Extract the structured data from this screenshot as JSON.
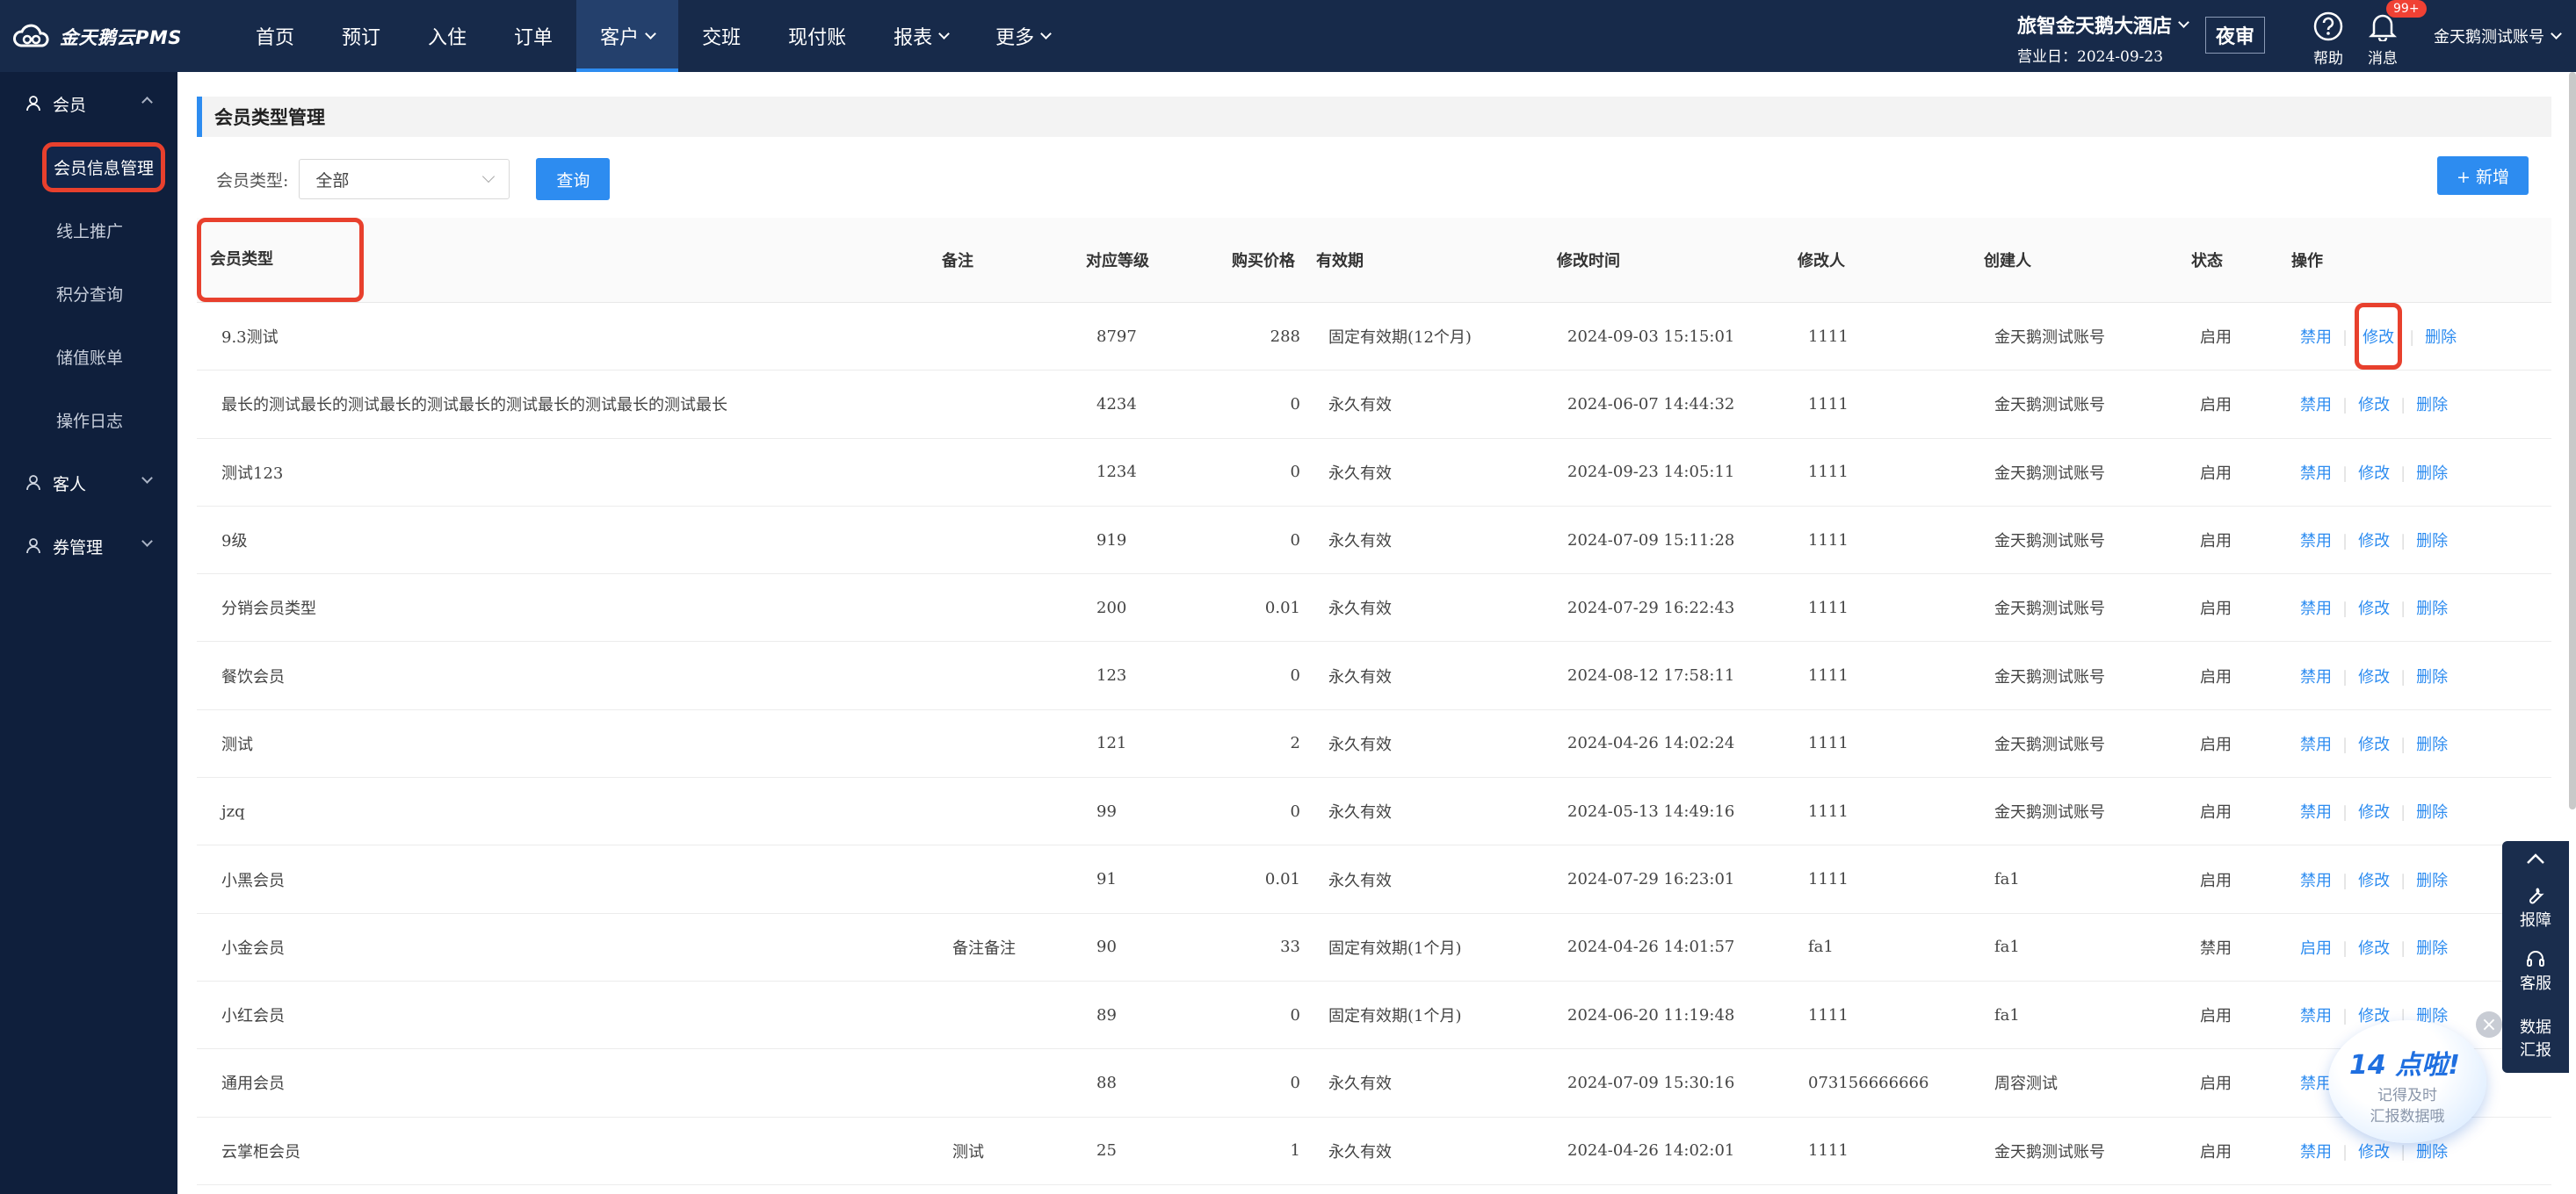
{
  "app": {
    "logo_text": "金天鹅云PMS"
  },
  "nav": {
    "items": [
      {
        "label": "首页"
      },
      {
        "label": "预订"
      },
      {
        "label": "入住"
      },
      {
        "label": "订单"
      },
      {
        "label": "客户"
      },
      {
        "label": "交班"
      },
      {
        "label": "现付账"
      },
      {
        "label": "报表"
      },
      {
        "label": "更多"
      }
    ]
  },
  "header": {
    "hotel_name": "旅智金天鹅大酒店",
    "business_date": "营业日：2024-09-23",
    "night_audit": "夜审",
    "help_label": "帮助",
    "message_label": "消息",
    "message_badge": "99+",
    "account": "金天鹅测试账号"
  },
  "sidebar": {
    "groups": [
      {
        "label": "会员",
        "items": [
          "会员信息管理",
          "线上推广",
          "积分查询",
          "储值账单",
          "操作日志"
        ]
      },
      {
        "label": "客人"
      },
      {
        "label": "券管理"
      }
    ]
  },
  "page": {
    "title": "会员类型管理",
    "filter_label": "会员类型:",
    "filter_value": "全部",
    "query_button": "查询",
    "add_button": "+ 新增"
  },
  "table": {
    "columns": [
      "会员类型",
      "备注",
      "对应等级",
      "购买价格",
      "有效期",
      "修改时间",
      "修改人",
      "创建人",
      "状态",
      "操作"
    ],
    "rows": [
      {
        "type": "9.3测试",
        "note": "",
        "level": "8797",
        "price": "288",
        "validity": "固定有效期(12个月)",
        "modified": "2024-09-03 15:15:01",
        "modifier": "1111",
        "creator": "金天鹅测试账号",
        "status": "启用",
        "toggle": "禁用"
      },
      {
        "type": "最长的测试最长的测试最长的测试最长的测试最长的测试最长的测试最长",
        "note": "",
        "level": "4234",
        "price": "0",
        "validity": "永久有效",
        "modified": "2024-06-07 14:44:32",
        "modifier": "1111",
        "creator": "金天鹅测试账号",
        "status": "启用",
        "toggle": "禁用"
      },
      {
        "type": "测试123",
        "note": "",
        "level": "1234",
        "price": "0",
        "validity": "永久有效",
        "modified": "2024-09-23 14:05:11",
        "modifier": "1111",
        "creator": "金天鹅测试账号",
        "status": "启用",
        "toggle": "禁用"
      },
      {
        "type": "9级",
        "note": "",
        "level": "919",
        "price": "0",
        "validity": "永久有效",
        "modified": "2024-07-09 15:11:28",
        "modifier": "1111",
        "creator": "金天鹅测试账号",
        "status": "启用",
        "toggle": "禁用"
      },
      {
        "type": "分销会员类型",
        "note": "",
        "level": "200",
        "price": "0.01",
        "validity": "永久有效",
        "modified": "2024-07-29 16:22:43",
        "modifier": "1111",
        "creator": "金天鹅测试账号",
        "status": "启用",
        "toggle": "禁用"
      },
      {
        "type": "餐饮会员",
        "note": "",
        "level": "123",
        "price": "0",
        "validity": "永久有效",
        "modified": "2024-08-12 17:58:11",
        "modifier": "1111",
        "creator": "金天鹅测试账号",
        "status": "启用",
        "toggle": "禁用"
      },
      {
        "type": "测试",
        "note": "",
        "level": "121",
        "price": "2",
        "validity": "永久有效",
        "modified": "2024-04-26 14:02:24",
        "modifier": "1111",
        "creator": "金天鹅测试账号",
        "status": "启用",
        "toggle": "禁用"
      },
      {
        "type": "jzq",
        "note": "",
        "level": "99",
        "price": "0",
        "validity": "永久有效",
        "modified": "2024-05-13 14:49:16",
        "modifier": "1111",
        "creator": "金天鹅测试账号",
        "status": "启用",
        "toggle": "禁用"
      },
      {
        "type": "小黑会员",
        "note": "",
        "level": "91",
        "price": "0.01",
        "validity": "永久有效",
        "modified": "2024-07-29 16:23:01",
        "modifier": "1111",
        "creator": "fa1",
        "status": "启用",
        "toggle": "禁用"
      },
      {
        "type": "小金会员",
        "note": "备注备注",
        "level": "90",
        "price": "33",
        "validity": "固定有效期(1个月)",
        "modified": "2024-04-26 14:01:57",
        "modifier": "fa1",
        "creator": "fa1",
        "status": "禁用",
        "toggle": "启用"
      },
      {
        "type": "小红会员",
        "note": "",
        "level": "89",
        "price": "0",
        "validity": "固定有效期(1个月)",
        "modified": "2024-06-20 11:19:48",
        "modifier": "1111",
        "creator": "fa1",
        "status": "启用",
        "toggle": "禁用"
      },
      {
        "type": "通用会员",
        "note": "",
        "level": "88",
        "price": "0",
        "validity": "永久有效",
        "modified": "2024-07-09 15:30:16",
        "modifier": "073156666666",
        "creator": "周容测试",
        "status": "启用",
        "toggle": "禁用"
      },
      {
        "type": "云掌柜会员",
        "note": "测试",
        "level": "25",
        "price": "1",
        "validity": "永久有效",
        "modified": "2024-04-26 14:02:01",
        "modifier": "1111",
        "creator": "金天鹅测试账号",
        "status": "启用",
        "toggle": "禁用"
      }
    ],
    "action_edit": "修改",
    "action_delete": "删除"
  },
  "tools": {
    "report_issue": "报障",
    "service": "客服",
    "data_report": "数据汇报"
  },
  "promo": {
    "title": "14 点啦!",
    "line1": "记得及时",
    "line2": "汇报数据哦"
  },
  "colors": {
    "nav_bg": "#172a4a",
    "sidebar_bg": "#0f1f3c",
    "accent": "#2d8cf0",
    "highlight": "#e8402d"
  }
}
